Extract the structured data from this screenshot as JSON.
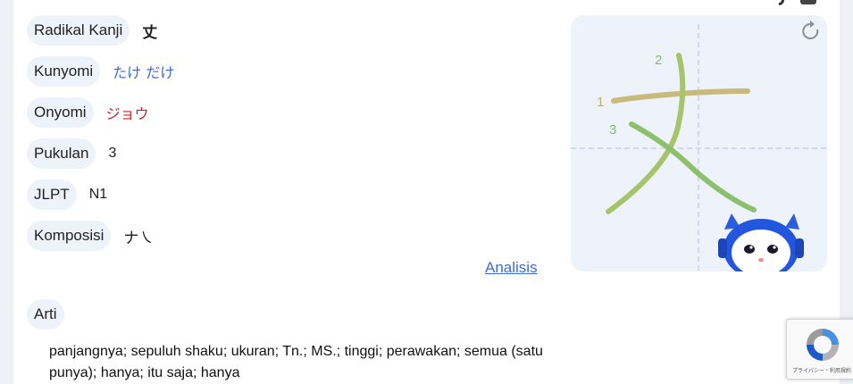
{
  "details": {
    "radikal": {
      "label": "Radikal Kanji",
      "value": "丈"
    },
    "kunyomi": {
      "label": "Kunyomi",
      "value": "たけ だけ"
    },
    "onyomi": {
      "label": "Onyomi",
      "value": "ジョウ"
    },
    "pukulan": {
      "label": "Pukulan",
      "value": "3"
    },
    "jlpt": {
      "label": "JLPT",
      "value": "N1"
    },
    "komposisi": {
      "label": "Komposisi",
      "value": "ナ㇏"
    }
  },
  "analisis_link": "Analisis",
  "arti": {
    "label": "Arti",
    "description": "panjangnya; sepuluh shaku; ukuran; Tn.; MS.; tinggi; perawakan; semua (satu punya); hanya; itu saja; hanya"
  },
  "stroke_order": {
    "numbers": [
      "1",
      "2",
      "3"
    ],
    "colors": {
      "stroke1": "#c9b97a",
      "stroke2": "#a8c46a",
      "stroke3": "#8cc06c",
      "numbers": "#8bb86a"
    }
  },
  "recaptcha": {
    "text": "プライバシー・利用規約"
  }
}
